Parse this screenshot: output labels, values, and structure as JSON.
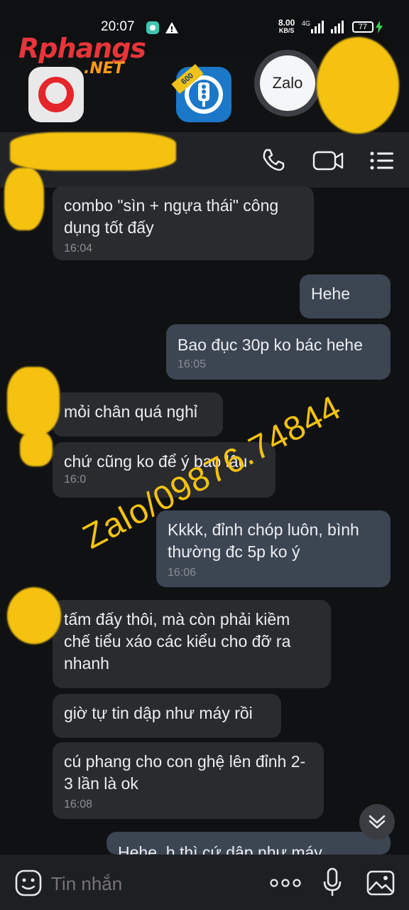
{
  "status_bar": {
    "time": "20:07",
    "speed_value": "8.00",
    "speed_unit": "KB/S",
    "network": "4G",
    "battery": "77"
  },
  "watermark_logo": {
    "main": "Rphangs",
    "suffix": ".NET"
  },
  "home_apps": [
    {
      "name": "app-red-icon"
    },
    {
      "name": "traffic-app-icon",
      "badge": "600"
    },
    {
      "name": "zalo-app-icon",
      "label": "Zalo"
    }
  ],
  "header": {
    "icons": [
      "phone-icon",
      "video-call-icon",
      "menu-icon"
    ]
  },
  "messages": [
    {
      "dir": "in",
      "text": "combo \"sìn + ngựa thái\" công dụng tốt đấy",
      "time": "16:04"
    },
    {
      "dir": "out",
      "text": "Hehe",
      "time": ""
    },
    {
      "dir": "out",
      "text": "Bao đục 30p ko bác hehe",
      "time": "16:05"
    },
    {
      "dir": "in",
      "text": "mỏi chân quá nghỉ",
      "time": ""
    },
    {
      "dir": "in",
      "text": "chứ cũng ko để ý bao lâu",
      "time": "16:0"
    },
    {
      "dir": "out",
      "text": "Kkkk, đỉnh chóp luôn, bình thường đc 5p ko ý",
      "time": "16:06"
    },
    {
      "dir": "in",
      "text": "tấm đấy thôi, mà còn phải kiềm chế tiểu xáo các kiểu cho đỡ ra nhanh",
      "time": ""
    },
    {
      "dir": "in",
      "text": "giờ tự tin dập như máy rồi",
      "time": ""
    },
    {
      "dir": "in",
      "text": "cú phang cho con ghệ lên đỉnh 2-3 lần là ok",
      "time": "16:08"
    },
    {
      "dir": "out",
      "text": "Hehe, h thì cứ dập như máy",
      "time": ""
    }
  ],
  "overlay_text": "Zalo/09876.74844",
  "composer": {
    "placeholder": "Tin nhắn"
  },
  "colors": {
    "highlight": "#f4c20f",
    "outgoing": "#3c4552",
    "incoming": "#2a2b2f"
  }
}
